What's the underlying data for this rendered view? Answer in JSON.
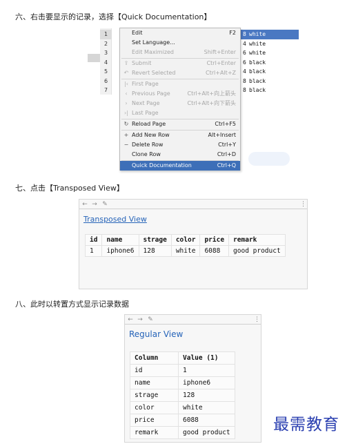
{
  "steps": {
    "s6": "六、右击要显示的记录，选择【Quick Documentation】",
    "s7": "七、点击【Transposed View】",
    "s8": "八、此时以转置方式显示记录数据"
  },
  "grid": {
    "rows": [
      {
        "num": "1",
        "pre": "8",
        "color": "white"
      },
      {
        "num": "2",
        "pre": "4",
        "color": "white"
      },
      {
        "num": "3",
        "pre": "6",
        "color": "white"
      },
      {
        "num": "4",
        "pre": "6",
        "color": "black"
      },
      {
        "num": "5",
        "pre": "4",
        "color": "black"
      },
      {
        "num": "6",
        "pre": "8",
        "color": "black"
      },
      {
        "num": "7",
        "pre": "8",
        "color": "black"
      }
    ]
  },
  "context_menu": {
    "items": [
      {
        "label": "Edit",
        "key": "F2",
        "icon": "",
        "state": "enabled"
      },
      {
        "label": "Set Language...",
        "key": "",
        "icon": "",
        "state": "enabled"
      },
      {
        "label": "Edit Maximized",
        "key": "Shift+Enter",
        "icon": "",
        "state": "disabled"
      },
      {
        "label": "Submit",
        "key": "Ctrl+Enter",
        "icon": "upload-icon",
        "state": "disabled"
      },
      {
        "label": "Revert Selected",
        "key": "Ctrl+Alt+Z",
        "icon": "revert-icon",
        "state": "disabled"
      },
      {
        "label": "First Page",
        "key": "",
        "icon": "first-page-icon",
        "state": "disabled"
      },
      {
        "label": "Previous Page",
        "key": "Ctrl+Alt+向上箭头",
        "icon": "prev-page-icon",
        "state": "disabled"
      },
      {
        "label": "Next Page",
        "key": "Ctrl+Alt+向下箭头",
        "icon": "next-page-icon",
        "state": "disabled"
      },
      {
        "label": "Last Page",
        "key": "",
        "icon": "last-page-icon",
        "state": "disabled"
      },
      {
        "label": "Reload Page",
        "key": "Ctrl+F5",
        "icon": "reload-icon",
        "state": "enabled"
      },
      {
        "label": "Add New Row",
        "key": "Alt+Insert",
        "icon": "plus-icon",
        "state": "enabled"
      },
      {
        "label": "Delete Row",
        "key": "Ctrl+Y",
        "icon": "minus-icon",
        "state": "enabled"
      },
      {
        "label": "Clone Row",
        "key": "Ctrl+D",
        "icon": "",
        "state": "enabled"
      },
      {
        "label": "Quick Documentation",
        "key": "Ctrl+Q",
        "icon": "",
        "state": "active"
      }
    ]
  },
  "icons": {
    "back": "←",
    "forward": "→",
    "edit": "✎",
    "more": "⋮",
    "upload": "⇪",
    "revert": "↶",
    "first": "|‹",
    "prev": "‹",
    "next": "›",
    "last": "›|",
    "reload": "↻",
    "plus": "+",
    "minus": "−"
  },
  "transposed_window": {
    "link": "Transposed View",
    "headers": [
      "id",
      "name",
      "strage",
      "color",
      "price",
      "remark"
    ],
    "row": [
      "1",
      "iphone6",
      "128",
      "white",
      "6088",
      "good product"
    ]
  },
  "regular_window": {
    "link": "Regular View",
    "headers": [
      "Column",
      "Value (1)"
    ],
    "rows": [
      [
        "id",
        "1"
      ],
      [
        "name",
        "iphone6"
      ],
      [
        "strage",
        "128"
      ],
      [
        "color",
        "white"
      ],
      [
        "price",
        "6088"
      ],
      [
        "remark",
        "good product"
      ]
    ]
  },
  "watermark": "最需教育",
  "colors": {
    "menu_highlight": "#3d6fb8",
    "row_selection": "#4a78c2",
    "link": "#2563b8",
    "watermark": "#2a3fb0"
  }
}
